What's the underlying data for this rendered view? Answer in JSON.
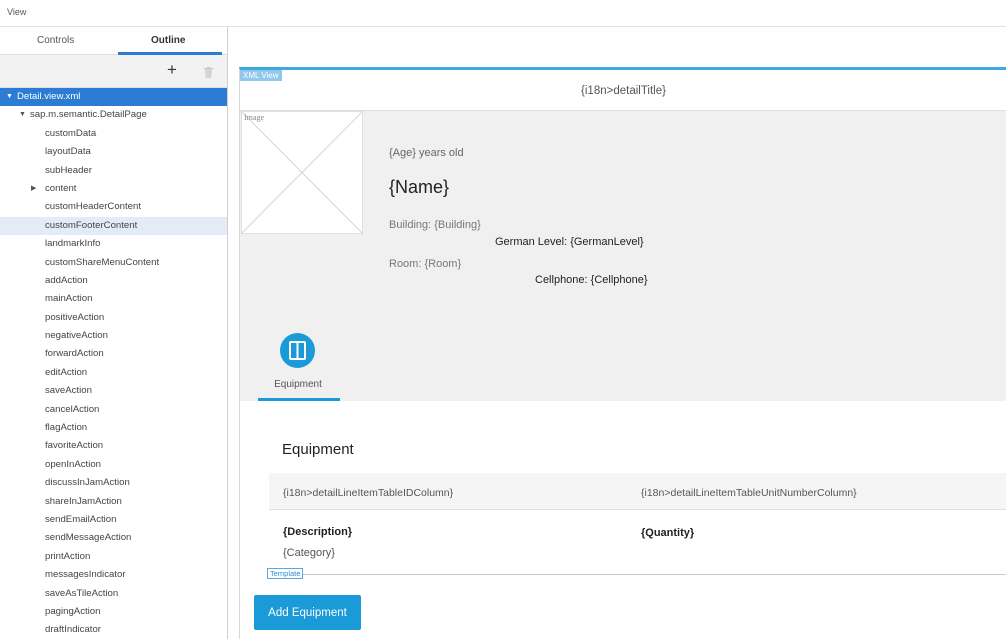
{
  "app": {
    "view_label": "View"
  },
  "panel": {
    "tabs": [
      {
        "label": "Controls"
      },
      {
        "label": "Outline"
      }
    ],
    "toolbar": {
      "add_label": "+"
    }
  },
  "tree": [
    {
      "label": "Detail.view.xml",
      "level": 0,
      "expander": "down",
      "selected": true
    },
    {
      "label": "sap.m.semantic.DetailPage",
      "level": 1,
      "expander": "down"
    },
    {
      "label": "customData",
      "level": 2
    },
    {
      "label": "layoutData",
      "level": 2
    },
    {
      "label": "subHeader",
      "level": 2
    },
    {
      "label": "content",
      "level": 2,
      "expander": "right"
    },
    {
      "label": "customHeaderContent",
      "level": 2
    },
    {
      "label": "customFooterContent",
      "level": 2,
      "hover": true
    },
    {
      "label": "landmarkInfo",
      "level": 2
    },
    {
      "label": "customShareMenuContent",
      "level": 2
    },
    {
      "label": "addAction",
      "level": 2
    },
    {
      "label": "mainAction",
      "level": 2
    },
    {
      "label": "positiveAction",
      "level": 2
    },
    {
      "label": "negativeAction",
      "level": 2
    },
    {
      "label": "forwardAction",
      "level": 2
    },
    {
      "label": "editAction",
      "level": 2
    },
    {
      "label": "saveAction",
      "level": 2
    },
    {
      "label": "cancelAction",
      "level": 2
    },
    {
      "label": "flagAction",
      "level": 2
    },
    {
      "label": "favoriteAction",
      "level": 2
    },
    {
      "label": "openInAction",
      "level": 2
    },
    {
      "label": "discussInJamAction",
      "level": 2
    },
    {
      "label": "shareInJamAction",
      "level": 2
    },
    {
      "label": "sendEmailAction",
      "level": 2
    },
    {
      "label": "sendMessageAction",
      "level": 2
    },
    {
      "label": "printAction",
      "level": 2
    },
    {
      "label": "messagesIndicator",
      "level": 2
    },
    {
      "label": "saveAsTileAction",
      "level": 2
    },
    {
      "label": "pagingAction",
      "level": 2
    },
    {
      "label": "draftIndicator",
      "level": 2
    }
  ],
  "canvas": {
    "xml_tag": "XML View",
    "title": "{i18n>detailTitle}",
    "image_label": "Image",
    "age": "{Age} years old",
    "name": "{Name}",
    "building": "Building: {Building}",
    "german": "German Level: {GermanLevel}",
    "room": "Room: {Room}",
    "cellphone": "Cellphone: {Cellphone}",
    "icon_tab_label": "Equipment",
    "section_title": "Equipment",
    "table_headers": [
      "{i18n>detailLineItemTableIDColumn}",
      "{i18n>detailLineItemTableUnitNumberColumn}"
    ],
    "row": {
      "description": "{Description}",
      "category": "{Category}",
      "quantity": "{Quantity}"
    },
    "template_tag": "Template",
    "add_button": "Add Equipment"
  },
  "colors": {
    "accent": "#1a9ad6",
    "selection": "#2b7cd3",
    "hover": "#e3ecf6"
  }
}
